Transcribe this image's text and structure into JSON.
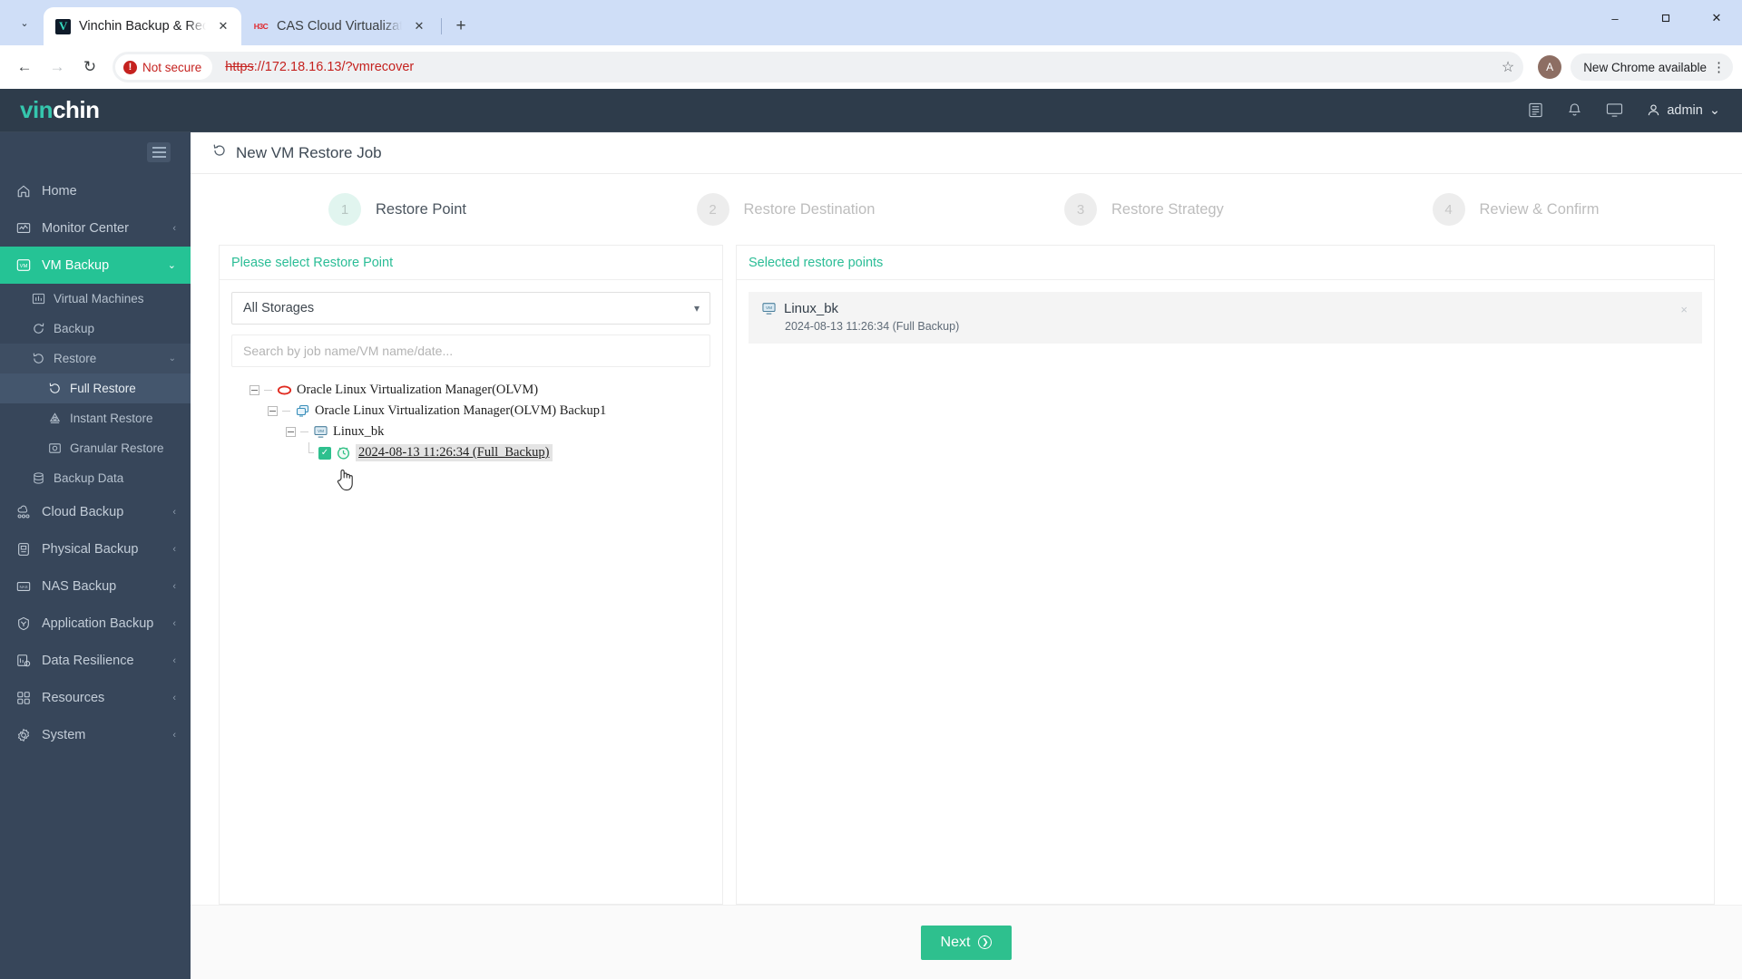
{
  "browser": {
    "tabs": [
      {
        "title": "Vinchin Backup & Recovery",
        "favicon": "vinchin-favicon",
        "active": true
      },
      {
        "title": "CAS Cloud Virtualization Ma",
        "favicon": "h3c-favicon",
        "active": false
      }
    ],
    "new_tab_label": "+",
    "tab_close_label": "✕",
    "tabstrip_caret_label": "⌄",
    "window_buttons": {
      "minimize": "–",
      "maximize": "❐",
      "close": "✕"
    },
    "nav": {
      "back": "←",
      "forward": "→",
      "reload": "↻"
    },
    "omnibox": {
      "security_label": "Not secure",
      "security_icon_glyph": "!",
      "url_scheme": "https",
      "url_rest": "://172.18.16.13/?vmrecover",
      "bookmark_icon": "☆"
    },
    "profile_initial": "A",
    "update_pill": "New Chrome available",
    "kebab": "⋮"
  },
  "app_header": {
    "logo_part1": "vin",
    "logo_part2": "chin",
    "icons": [
      "list-icon",
      "bell-icon",
      "monitor-icon"
    ],
    "user_label": "admin",
    "user_caret": "⌄"
  },
  "sidebar": {
    "items": [
      {
        "label": "Home",
        "icon": "home-icon",
        "level": 1,
        "state": "normal",
        "chevron": ""
      },
      {
        "label": "Monitor Center",
        "icon": "monitor-center-icon",
        "level": 1,
        "state": "normal",
        "chevron": "‹"
      },
      {
        "label": "VM Backup",
        "icon": "vm-icon",
        "level": 1,
        "state": "active",
        "chevron": "⌄"
      },
      {
        "label": "Virtual Machines",
        "icon": "virtual-machines-icon",
        "level": 2,
        "state": "normal",
        "chevron": ""
      },
      {
        "label": "Backup",
        "icon": "backup-icon",
        "level": 2,
        "state": "normal",
        "chevron": ""
      },
      {
        "label": "Restore",
        "icon": "restore-icon",
        "level": 2,
        "state": "open",
        "chevron": "⌄"
      },
      {
        "label": "Full Restore",
        "icon": "full-restore-icon",
        "level": 3,
        "state": "current",
        "chevron": ""
      },
      {
        "label": "Instant Restore",
        "icon": "instant-restore-icon",
        "level": 3,
        "state": "normal",
        "chevron": ""
      },
      {
        "label": "Granular Restore",
        "icon": "granular-restore-icon",
        "level": 3,
        "state": "normal",
        "chevron": ""
      },
      {
        "label": "Backup Data",
        "icon": "backup-data-icon",
        "level": 2,
        "state": "normal",
        "chevron": ""
      },
      {
        "label": "Cloud Backup",
        "icon": "cloud-backup-icon",
        "level": 1,
        "state": "normal",
        "chevron": "‹"
      },
      {
        "label": "Physical Backup",
        "icon": "physical-backup-icon",
        "level": 1,
        "state": "normal",
        "chevron": "‹"
      },
      {
        "label": "NAS Backup",
        "icon": "nas-backup-icon",
        "level": 1,
        "state": "normal",
        "chevron": "‹"
      },
      {
        "label": "Application Backup",
        "icon": "application-backup-icon",
        "level": 1,
        "state": "normal",
        "chevron": "‹"
      },
      {
        "label": "Data Resilience",
        "icon": "data-resilience-icon",
        "level": 1,
        "state": "normal",
        "chevron": "‹"
      },
      {
        "label": "Resources",
        "icon": "resources-icon",
        "level": 1,
        "state": "normal",
        "chevron": "‹"
      },
      {
        "label": "System",
        "icon": "system-icon",
        "level": 1,
        "state": "normal",
        "chevron": "‹"
      }
    ]
  },
  "page": {
    "title": "New VM Restore Job",
    "title_icon": "restore-arrow-icon"
  },
  "steps": [
    {
      "number": "1",
      "label": "Restore Point",
      "active": true
    },
    {
      "number": "2",
      "label": "Restore Destination",
      "active": false
    },
    {
      "number": "3",
      "label": "Restore Strategy",
      "active": false
    },
    {
      "number": "4",
      "label": "Review & Confirm",
      "active": false
    }
  ],
  "left_panel": {
    "header": "Please select Restore Point",
    "storage_select": {
      "value": "All Storages",
      "options": [
        "All Storages"
      ]
    },
    "search": {
      "value": "",
      "placeholder": "Search by job name/VM name/date..."
    },
    "tree": [
      {
        "level": 1,
        "label": "Oracle Linux Virtualization Manager(OLVM)",
        "icon": "olvm-host-icon",
        "expander": "minus",
        "checkbox": false,
        "selected": false
      },
      {
        "level": 2,
        "label": "Oracle Linux Virtualization Manager(OLVM) Backup1",
        "icon": "backup-job-icon",
        "expander": "minus",
        "checkbox": false,
        "selected": false
      },
      {
        "level": 3,
        "label": "Linux_bk",
        "icon": "vm-node-icon",
        "expander": "minus",
        "checkbox": false,
        "selected": false
      },
      {
        "level": 4,
        "label": "2024-08-13 11:26:34 (Full_Backup)",
        "icon": "clock-icon",
        "expander": "leaf",
        "checkbox": true,
        "selected": true
      }
    ]
  },
  "right_panel": {
    "header": "Selected restore points",
    "cards": [
      {
        "name": "Linux_bk",
        "detail": "2024-08-13 11:26:34 (Full Backup)",
        "icon": "vm-node-icon",
        "close_label": "×"
      }
    ]
  },
  "footer": {
    "next_label": "Next",
    "next_icon_glyph": "➤"
  },
  "colors": {
    "accent_green": "#2ec08e",
    "sidebar_active": "#25c395",
    "sidebar_bg": "#37465a",
    "header_bg": "#2e3c4b",
    "panel_header_text": "#2bbd96",
    "not_secure_red": "#c5221f"
  }
}
